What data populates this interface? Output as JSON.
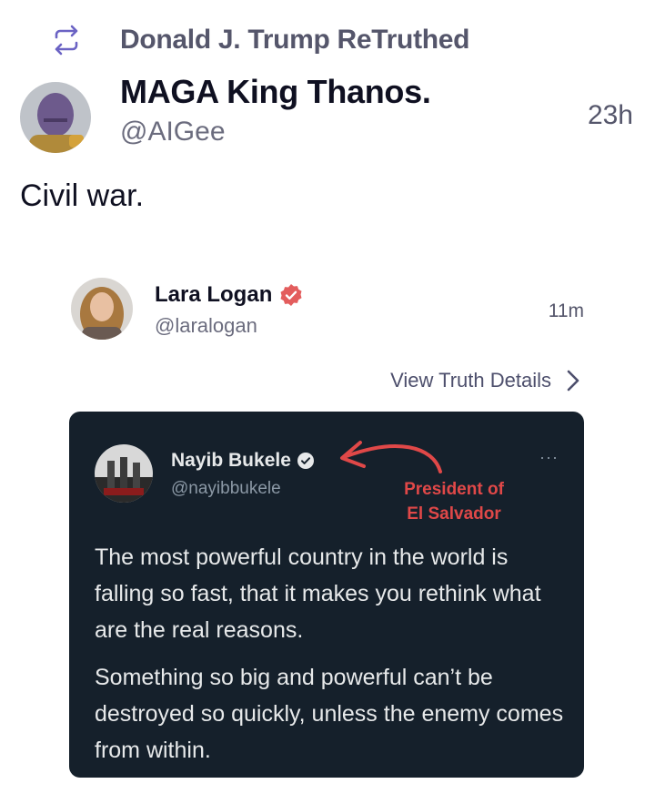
{
  "retruth": {
    "label": "Donald J. Trump ReTruthed",
    "icon": "retruth-icon"
  },
  "post": {
    "display_name": "MAGA King Thanos.",
    "handle": "@AIGee",
    "time": "23h",
    "text": "Civil war."
  },
  "quoted": {
    "display_name": "Lara Logan",
    "handle": "@laralogan",
    "time": "11m",
    "view_details": "View Truth Details",
    "verified_icon": "verified-badge-icon",
    "badge_color": "#e35d5d"
  },
  "tweet_image": {
    "name": "Nayib Bukele",
    "handle": "@nayibbukele",
    "more": "···",
    "annotation_line1": "President of",
    "annotation_line2": "El Salvador",
    "paragraph1": "The most powerful country in the world is falling so fast, that it makes you rethink what are the real reasons.",
    "paragraph2": "Something so big and powerful can’t be destroyed so quickly, unless the enemy comes from within.",
    "background": "#15202b",
    "annotation_color": "#e04848"
  },
  "colors": {
    "primary_text": "#0f1021",
    "secondary_text": "#6b6c7e",
    "accent": "#4d4f6c"
  }
}
